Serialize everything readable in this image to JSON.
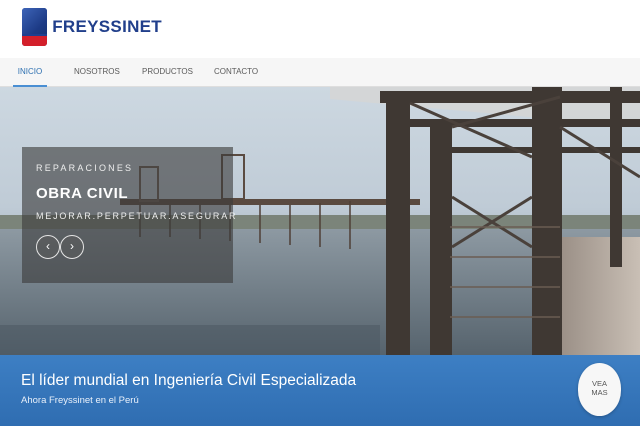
{
  "brand": {
    "name": "FREYSSINET",
    "mark_colors": {
      "top": "#2a4f9f",
      "bottom": "#d31f2a"
    }
  },
  "nav": {
    "items": [
      {
        "label": "INICIO",
        "active": true
      },
      {
        "label": "NOSOTROS",
        "active": false
      },
      {
        "label": "PRODUCTOS",
        "active": false
      },
      {
        "label": "CONTACTO",
        "active": false
      }
    ]
  },
  "slider": {
    "kicker": "REPARACIONES",
    "title": "OBRA CIVIL",
    "subtitle": "MEJORAR.PERPETUAR.ASEGURAR",
    "prev_icon": "chevron-left-icon",
    "next_icon": "chevron-right-icon",
    "prev_glyph": "‹",
    "next_glyph": "›"
  },
  "band": {
    "headline": "El líder mundial en Ingeniería Civil Especializada",
    "subline": "Ahora Freyssinet en el Perú",
    "cta": {
      "line1": "VEA",
      "line2": "MAS"
    },
    "color": "#3577bd"
  }
}
